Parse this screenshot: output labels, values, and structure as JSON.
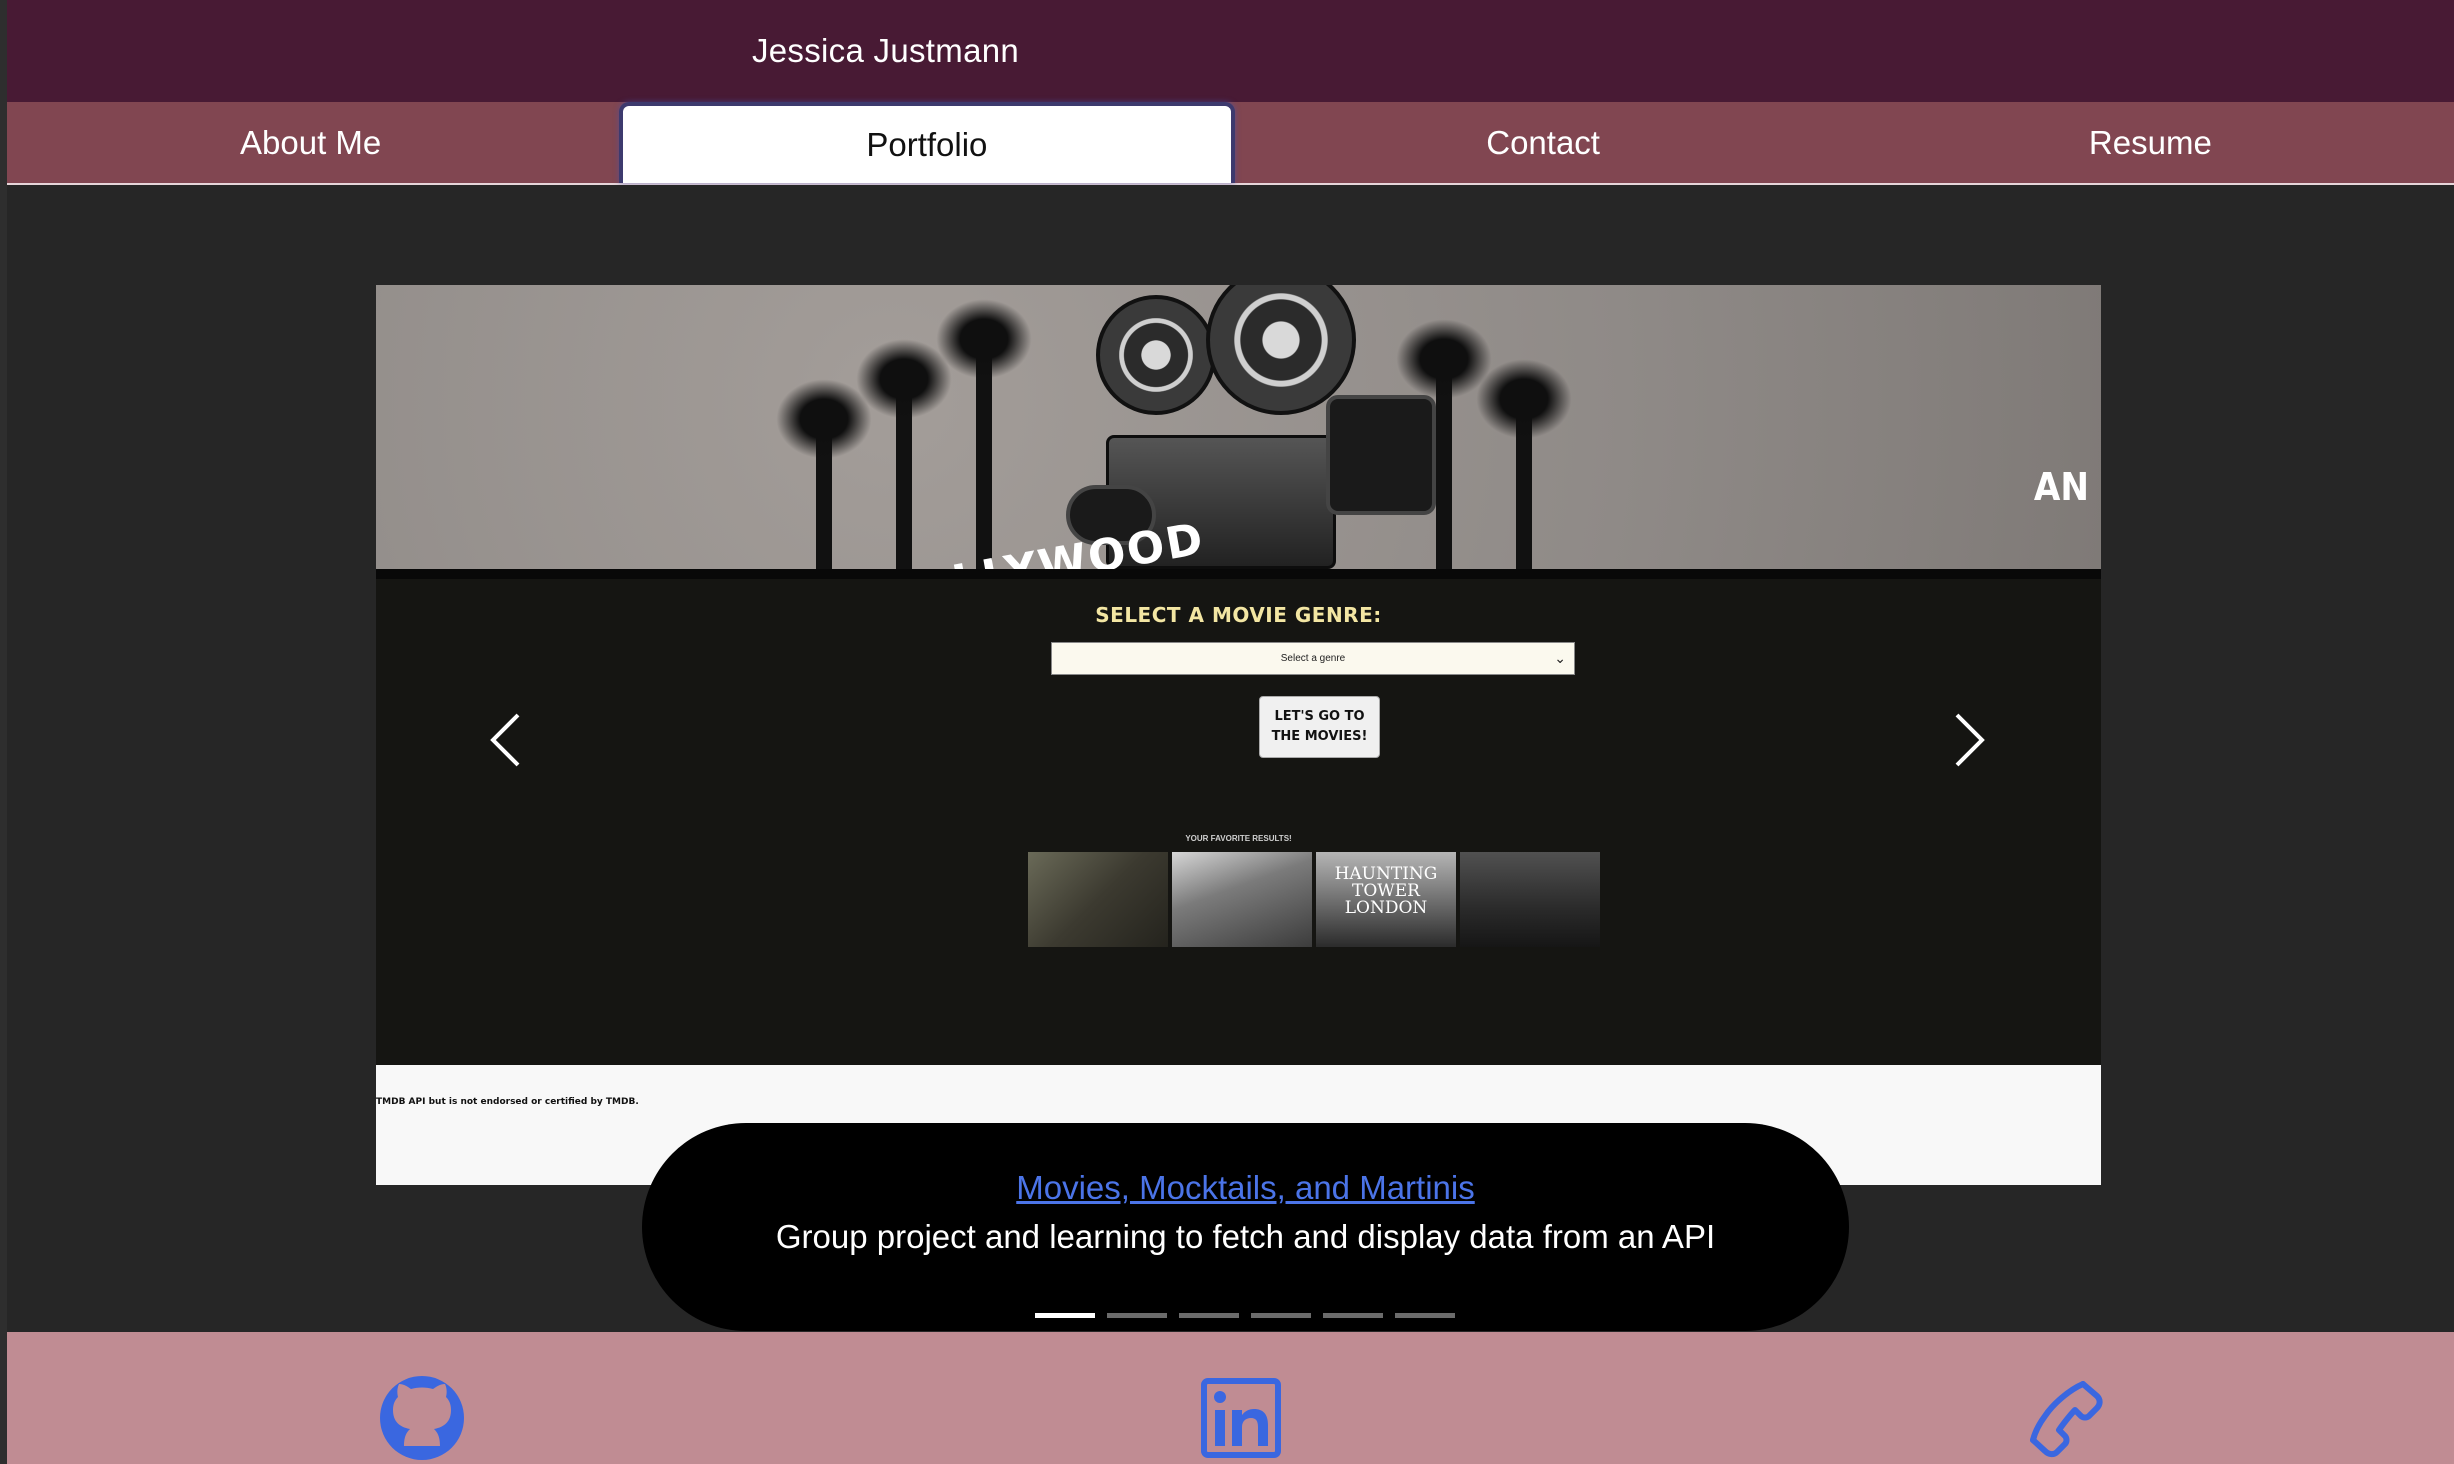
{
  "header": {
    "title": "Jessica Justmann"
  },
  "tabs": [
    {
      "label": "About Me"
    },
    {
      "label": "Portfolio"
    },
    {
      "label": "Contact"
    },
    {
      "label": "Resume"
    }
  ],
  "active_tab": "Portfolio",
  "slide": {
    "screenshot": {
      "hero_left_text": "LLYWOOD",
      "hero_right_text": "AN",
      "genre_label": "SELECT A MOVIE GENRE:",
      "genre_select_value": "Select a genre",
      "go_button": "LET'S GO TO THE MOVIES!",
      "favorites_label": "YOUR FAVORITE RESULTS!",
      "poster_3_title": "HAUNTING TOWER LONDON",
      "tmdb_note": "TMDB API but is not endorsed or certified by TMDB."
    },
    "caption_title": "Movies, Mocktails, and Martinis",
    "caption_description": "Group project and learning to fetch and display data from an API"
  },
  "carousel": {
    "slide_count": 6,
    "active_index": 0
  },
  "footer": {
    "icons": [
      "github-icon",
      "linkedin-icon",
      "phone-icon"
    ],
    "icon_color": "#3a67e0"
  },
  "colors": {
    "header_bg": "#481a34",
    "tabs_bg": "#814651",
    "content_bg": "#262626",
    "footer_bg": "#c08c93",
    "link": "#4b74e8"
  }
}
